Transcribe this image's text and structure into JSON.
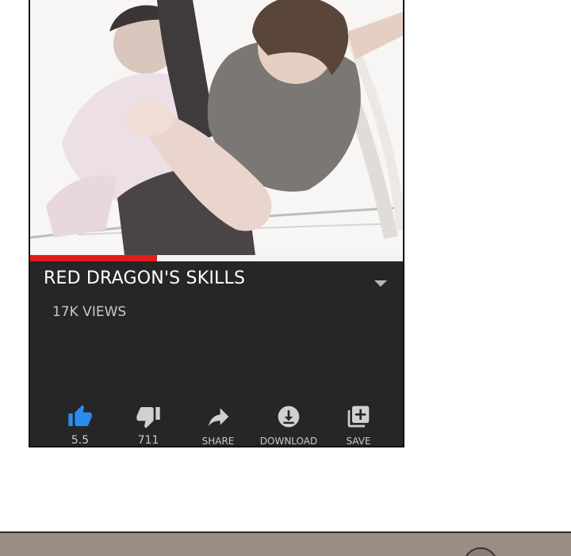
{
  "video": {
    "title": "RED DRAGON'S SKILLS",
    "views": "17K VIEWS",
    "progress": 0.34
  },
  "actions": [
    {
      "name": "like",
      "icon": "thumb-up-icon",
      "label": "5.5",
      "color": "#2b8cf0"
    },
    {
      "name": "dislike",
      "icon": "thumb-down-icon",
      "label": "711",
      "color": "#d0d0d0"
    },
    {
      "name": "share",
      "icon": "share-icon",
      "label": "SHARE",
      "color": "#d0d0d0"
    },
    {
      "name": "download",
      "icon": "download-icon",
      "label": "DOWNLOAD",
      "color": "#d0d0d0"
    },
    {
      "name": "save",
      "icon": "playlist-add-icon",
      "label": "SAVE",
      "color": "#d0d0d0"
    }
  ],
  "colors": {
    "card_bg": "#262626",
    "progress": "#e31b1b",
    "like_active": "#2b8cf0"
  }
}
